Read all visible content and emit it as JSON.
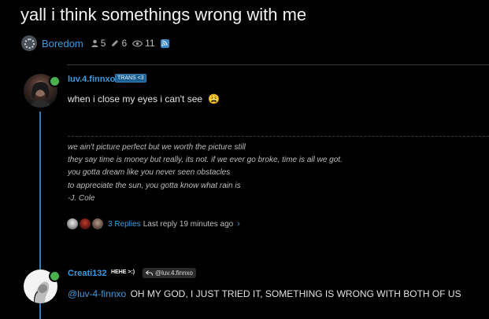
{
  "topic": {
    "title": "yall i think somethings wrong with me",
    "category": "Boredom",
    "posters_count": "5",
    "posts_count": "6",
    "views_count": "11"
  },
  "post1": {
    "username": "luv.4.finnxo",
    "badge": "TRANS <3",
    "text": "when i close my eyes i can't see",
    "emoji": "😩",
    "signature": [
      "we ain't picture perfect but we worth the picture still",
      "they say time is money but really, its not. if we ever go broke, time is all we got.",
      "you gotta dream like you never seen obstacles",
      "to appreciate the sun, you gotta know what rain is",
      "-J. Cole"
    ],
    "replies_label": "3 Replies",
    "last_reply": "Last reply 19 minutes ago"
  },
  "post2": {
    "username": "Creati132",
    "badge": "HEHE >:)",
    "reply_to": "@luv.4.finnxo",
    "mention": "@luv-4-finnxo",
    "text": "OH MY GOD, I JUST TRIED IT, SOMETHING IS WRONG WITH BOTH OF US"
  },
  "colors": {
    "accent": "#3a9ce0",
    "online": "#4caf50",
    "timeline": "#2f7fc0",
    "background": "#000000"
  },
  "icons": {
    "posters": "user-icon",
    "posts": "pencil-icon",
    "views": "eye-icon",
    "rss": "rss-icon",
    "reply": "reply-arrow-icon",
    "chevron": "chevron-right-icon"
  }
}
